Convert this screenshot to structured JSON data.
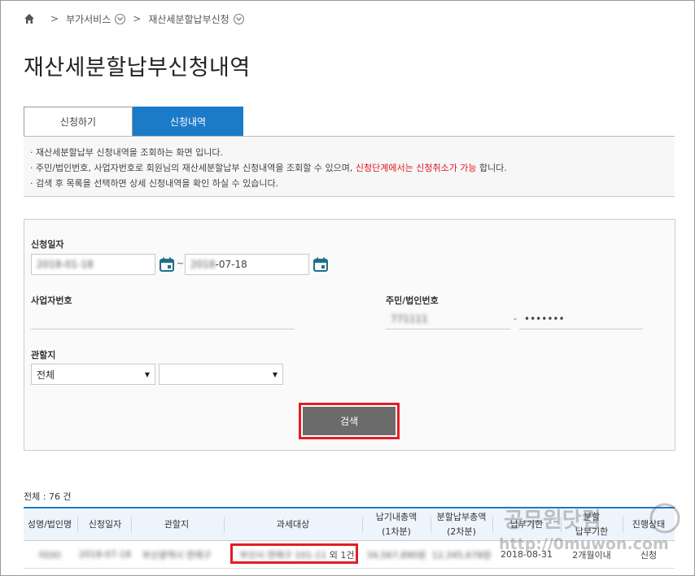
{
  "breadcrumb": {
    "item1": "부가서비스",
    "item2": "재산세분할납부신청"
  },
  "title": "재산세분할납부신청내역",
  "tabs": {
    "apply": "신청하기",
    "history": "신청내역"
  },
  "info": {
    "line1": "· 재산세분할납부 신청내역을 조회하는 화면 입니다.",
    "line2_pre": "· 주민/법인번호, 사업자번호로 회원님의 재산세분할납부 신청내역을 조회할 수 있으며, ",
    "line2_red": "신청단계에서는 신청취소가 가능",
    "line2_post": " 합니다.",
    "line3": "· 검색 후 목록을 선택하면 상세 신청내역을 확인 하실 수 있습니다."
  },
  "form": {
    "date_label": "신청일자",
    "date_from": "2018-01-18",
    "date_to_masked": "2018",
    "date_to_visible": "-07-18",
    "date_tilde": "~",
    "biz_label": "사업자번호",
    "biz_value": "",
    "rrn_label": "주민/법인번호",
    "rrn_front": "771111",
    "rrn_dash": "-",
    "rrn_back": "•••••••",
    "office_label": "관할지",
    "office_select1": "전체",
    "office_select2": "",
    "search_button": "검색"
  },
  "results": {
    "total": "전체 : 76 건",
    "headers": {
      "name": "성명/법인명",
      "date": "신청일자",
      "office": "관할지",
      "target": "과세대상",
      "first": "납기내총액\n(1차분)",
      "second": "분할납부총액\n(2차분)",
      "due": "납부기한",
      "split_due": "분할\n납부기한",
      "status": "진행상태"
    },
    "row": {
      "name": "이OO",
      "date": "2018-07-18",
      "office": "부산광역시 연제구",
      "target_blur": "부산시 연제구 101-11",
      "target_suffix": "외 1건",
      "first": "34,567,890원",
      "second": "12,345,678원",
      "due": "2018-08-31",
      "split_due": "2개월이내",
      "status": "신청"
    }
  },
  "watermark": {
    "line1": "공무원닷컴",
    "line2": "http://0muwon.com"
  }
}
